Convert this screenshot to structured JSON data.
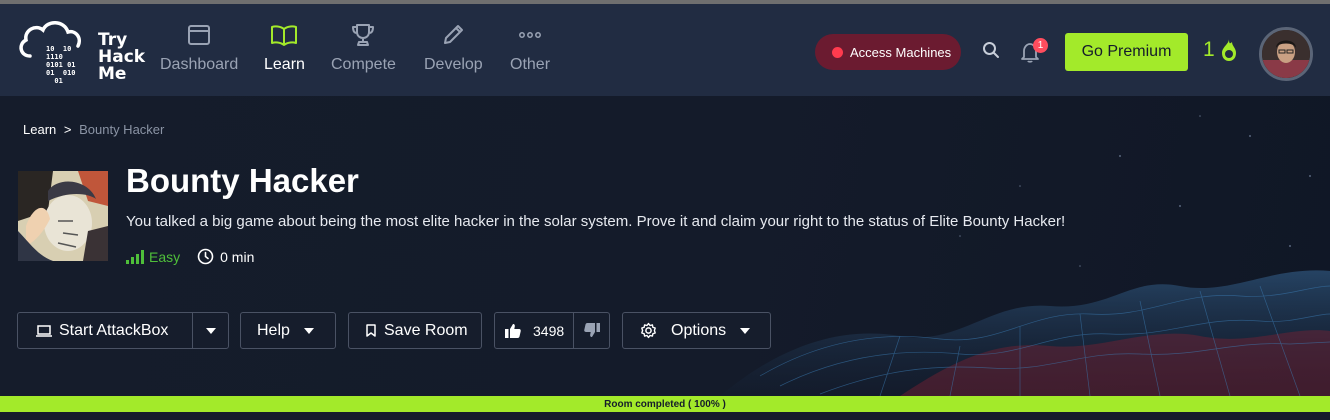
{
  "brand": {
    "name_line1": "Try",
    "name_line2": "Hack",
    "name_line3": "Me",
    "binary": "10  10\n1110\n0101 01\n01  010\n  01"
  },
  "nav": [
    {
      "label": "Dashboard",
      "icon": "dashboard-icon",
      "active": false
    },
    {
      "label": "Learn",
      "icon": "book-icon",
      "active": true
    },
    {
      "label": "Compete",
      "icon": "trophy-icon",
      "active": false
    },
    {
      "label": "Develop",
      "icon": "pencil-icon",
      "active": false
    },
    {
      "label": "Other",
      "icon": "more-icon",
      "active": false
    }
  ],
  "header": {
    "access_label": "Access Machines",
    "notification_count": "1",
    "premium_label": "Go Premium",
    "streak": "1"
  },
  "breadcrumb": {
    "root": "Learn",
    "separator": ">",
    "current": "Bounty Hacker"
  },
  "room": {
    "title": "Bounty Hacker",
    "description": "You talked a big game about being the most elite hacker in the solar system. Prove it and claim your right to the status of Elite Bounty Hacker!",
    "difficulty": "Easy",
    "duration": "0 min"
  },
  "actions": {
    "attackbox": "Start AttackBox",
    "help": "Help",
    "save": "Save Room",
    "likes": "3498",
    "options": "Options"
  },
  "progress": {
    "label": "Room completed ( 100% )",
    "percent": 100
  },
  "colors": {
    "accent": "#a3ea2a",
    "navbar": "#212c42",
    "background": "#151c2b",
    "danger": "#ff3b4e"
  }
}
